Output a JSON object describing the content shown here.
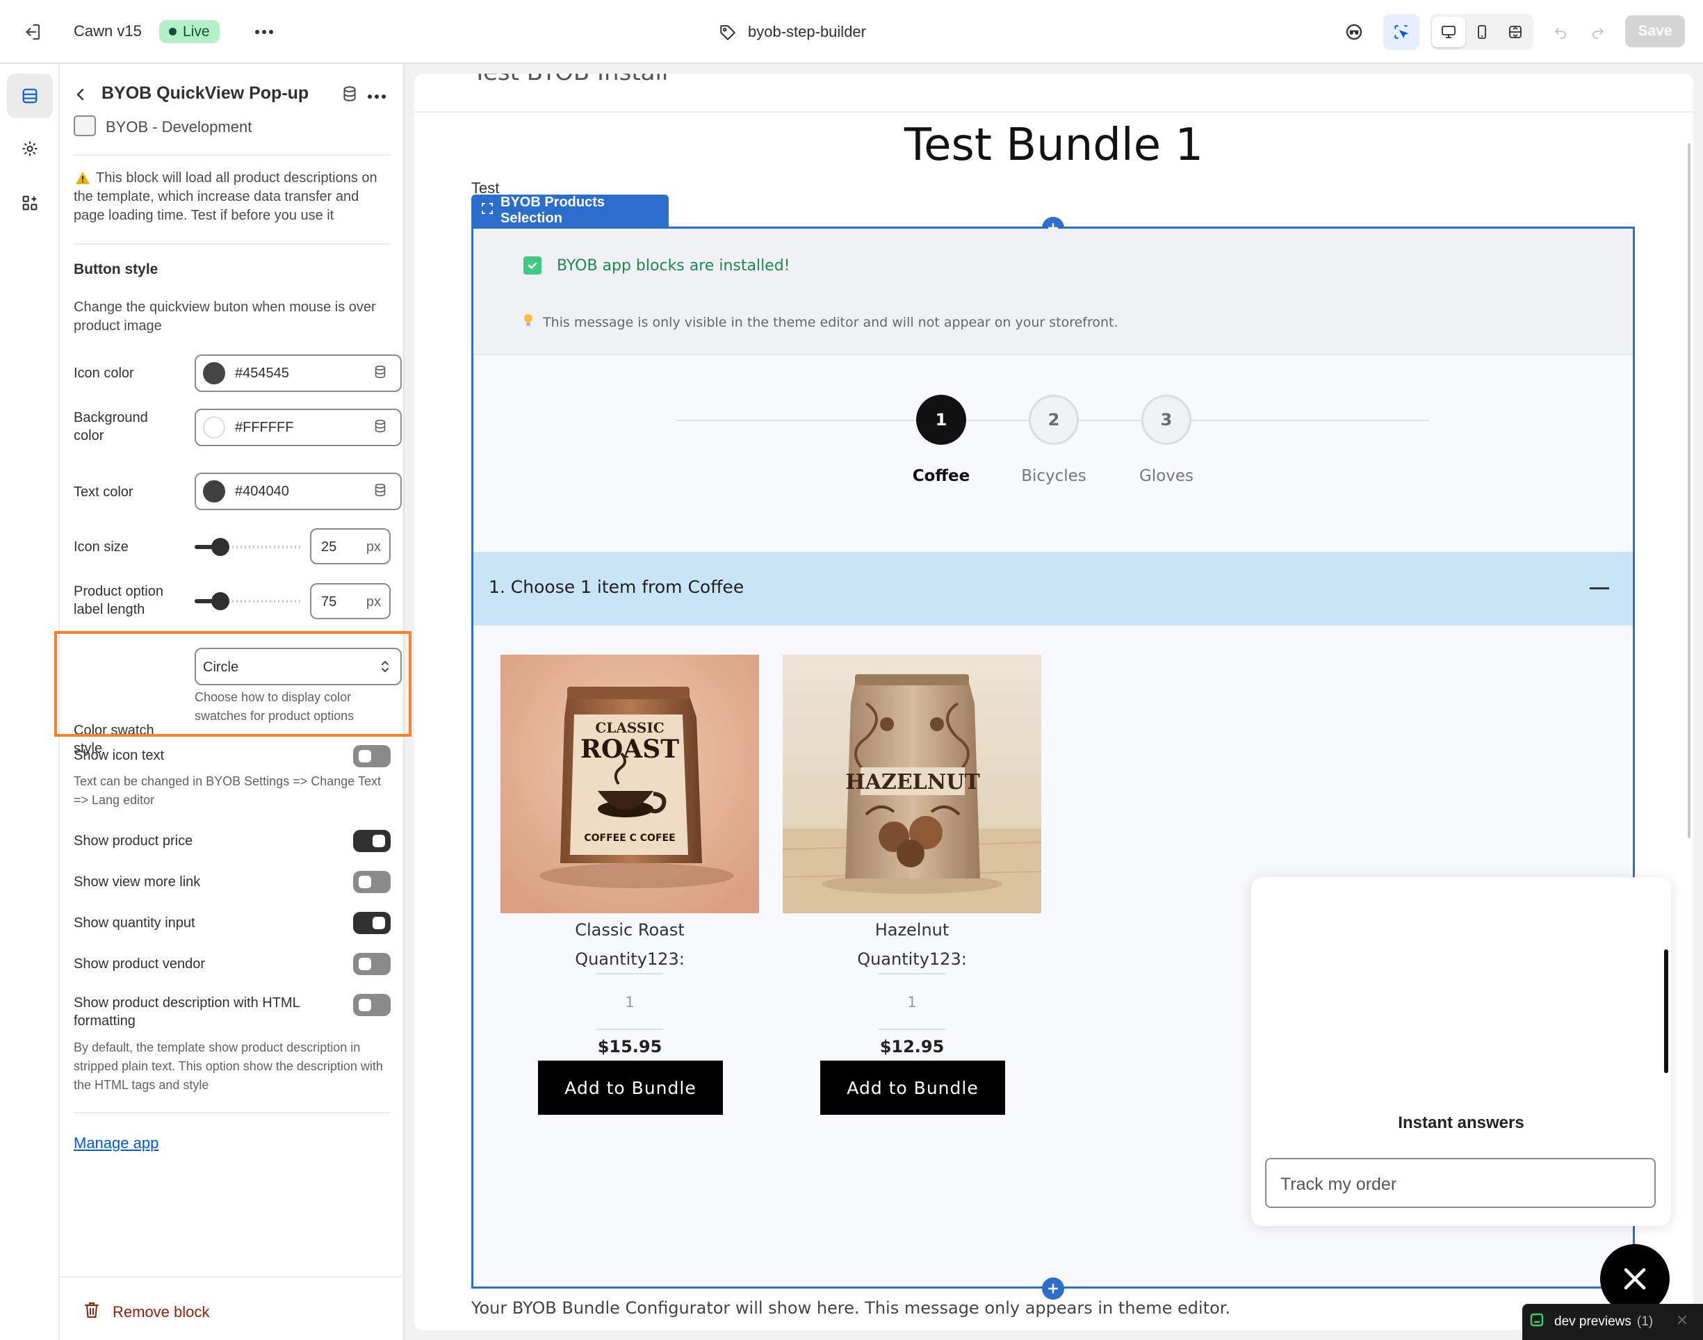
{
  "topbar": {
    "store_name": "Cawn v15",
    "status_badge": "Live",
    "template_name": "byob-step-builder",
    "save_label": "Save"
  },
  "panel": {
    "title": "BYOB QuickView Pop-up",
    "subtitle": "BYOB - Development",
    "warning": "This block will load all product descriptions on the template, which increase data transfer and page loading time. Test if before you use it",
    "section_heading": "Button style",
    "section_description": "Change the quickview buton when mouse is over product image",
    "icon_color": {
      "label": "Icon color",
      "value": "#454545"
    },
    "background_color": {
      "label": "Background color",
      "value": "#FFFFFF"
    },
    "text_color": {
      "label": "Text color",
      "value": "#404040"
    },
    "icon_size": {
      "label": "Icon size",
      "value": "25",
      "unit": "px"
    },
    "label_length": {
      "label": "Product option label length",
      "value": "75",
      "unit": "px"
    },
    "swatch_style": {
      "label": "Color swatch style",
      "value": "Circle",
      "help": "Choose how to display color swatches for product options"
    },
    "show_icon_text": {
      "label": "Show icon text",
      "help": "Text can be changed in BYOB Settings => Change Text => Lang editor",
      "on": false
    },
    "show_price": {
      "label": "Show product price",
      "on": true
    },
    "show_view_more": {
      "label": "Show view more link",
      "on": false
    },
    "show_qty": {
      "label": "Show quantity input",
      "on": true
    },
    "show_vendor": {
      "label": "Show product vendor",
      "on": false
    },
    "show_desc_html": {
      "label": "Show product description with HTML formatting",
      "help": "By default, the template show product description in stripped plain text. This option show the description with the HTML tags and style",
      "on": false
    },
    "manage_link": "Manage app",
    "remove_label": "Remove block"
  },
  "preview": {
    "header_cut_text": "Test BYOB Install",
    "page_title": "Test Bundle 1",
    "small_text": "Test",
    "block_tab": "BYOB Products Selection",
    "installed_msg": "BYOB app blocks are installed!",
    "tip_msg": "This message is only visible in the theme editor and will not appear on your storefront.",
    "steps": [
      {
        "num": "1",
        "label": "Coffee"
      },
      {
        "num": "2",
        "label": "Bicycles"
      },
      {
        "num": "3",
        "label": "Gloves"
      }
    ],
    "choose_text": "1. Choose 1 item from Coffee",
    "products": [
      {
        "name": "Classic Roast",
        "qty_label": "Quantity123:",
        "qty": "1",
        "price": "$15.95",
        "button": "Add to Bundle",
        "bag_top": "CLASSIC",
        "bag_main": "ROAST",
        "bag_bottom": "COFFEE C COFEE"
      },
      {
        "name": "Hazelnut",
        "qty_label": "Quantity123:",
        "qty": "1",
        "price": "$12.95",
        "button": "Add to Bundle",
        "bag_main": "HAZELNUT"
      }
    ],
    "footer_msg": "Your BYOB Bundle Configurator will show here. This message only appears in theme editor."
  },
  "widget": {
    "title": "Instant answers",
    "input_value": "Track my order"
  },
  "devbar": {
    "label": "dev previews",
    "count": "(1)"
  },
  "colors": {
    "accent_blue": "#2c6ecb",
    "highlight_orange": "#f97f2a",
    "live_green": "#b3f0c6",
    "link_blue": "#005bd3"
  }
}
